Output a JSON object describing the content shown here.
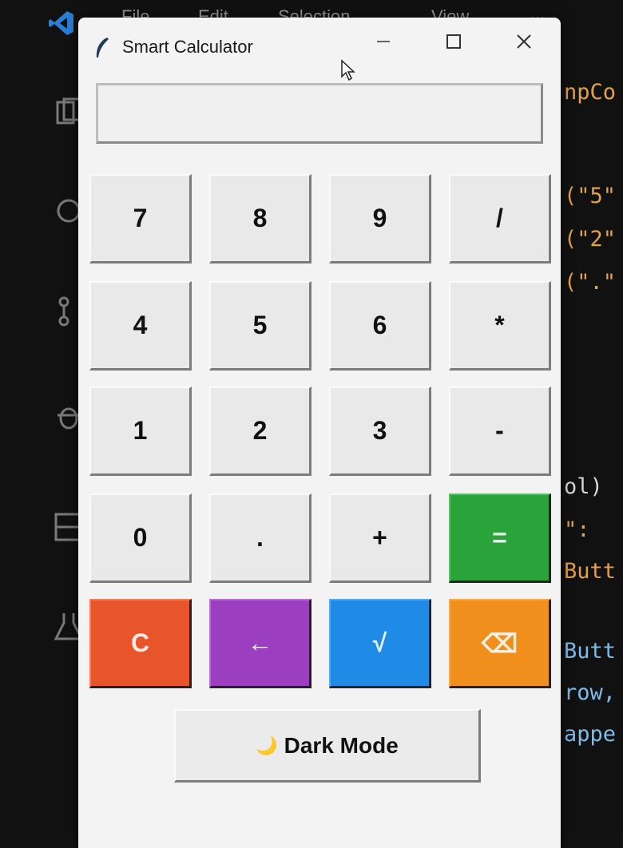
{
  "window": {
    "title": "Smart Calculator",
    "display_value": ""
  },
  "keypad": {
    "rows": [
      [
        {
          "label": "7"
        },
        {
          "label": "8"
        },
        {
          "label": "9"
        },
        {
          "label": "/"
        }
      ],
      [
        {
          "label": "4"
        },
        {
          "label": "5"
        },
        {
          "label": "6"
        },
        {
          "label": "*"
        }
      ],
      [
        {
          "label": "1"
        },
        {
          "label": "2"
        },
        {
          "label": "3"
        },
        {
          "label": "-"
        }
      ],
      [
        {
          "label": "0"
        },
        {
          "label": "."
        },
        {
          "label": "+"
        },
        {
          "label": "=",
          "color": "#2aa43a"
        }
      ],
      [
        {
          "label": "C",
          "color": "#e8552a"
        },
        {
          "label": "←",
          "color": "#9b3fc0"
        },
        {
          "label": "√",
          "color": "#1f8be6"
        },
        {
          "label": "⌫",
          "color": "#f08f1c"
        }
      ]
    ]
  },
  "dark_mode": {
    "label": "Dark Mode",
    "icon": "🌙"
  },
  "background_editor": {
    "menu": [
      "File",
      "Edit",
      "Selection",
      "View",
      "..."
    ],
    "code_lines": [
      {
        "text": "npCo",
        "color": "#e2a24a"
      },
      {
        "text": "(\"5\"",
        "color": "#e2a24a"
      },
      {
        "text": "(\"2\"",
        "color": "#e2a24a"
      },
      {
        "text": "(\".\"",
        "color": "#e2a24a"
      },
      {
        "text": "ol)",
        "color": "#d6d6d6"
      },
      {
        "text": "\":",
        "color": "#e2a24a"
      },
      {
        "text": "Butt",
        "color": "#e2a24a"
      },
      {
        "text": "Butt",
        "color": "#7fbcea"
      },
      {
        "text": "row,",
        "color": "#7fbcea"
      },
      {
        "text": "appe",
        "color": "#7fbcea"
      }
    ]
  },
  "colors": {
    "window_bg": "#f3f3f3",
    "key_bg": "#e9e9e9",
    "equals": "#2aa43a",
    "clear": "#e8552a",
    "back": "#9b3fc0",
    "sqrt": "#1f8be6",
    "delete": "#f08f1c"
  }
}
